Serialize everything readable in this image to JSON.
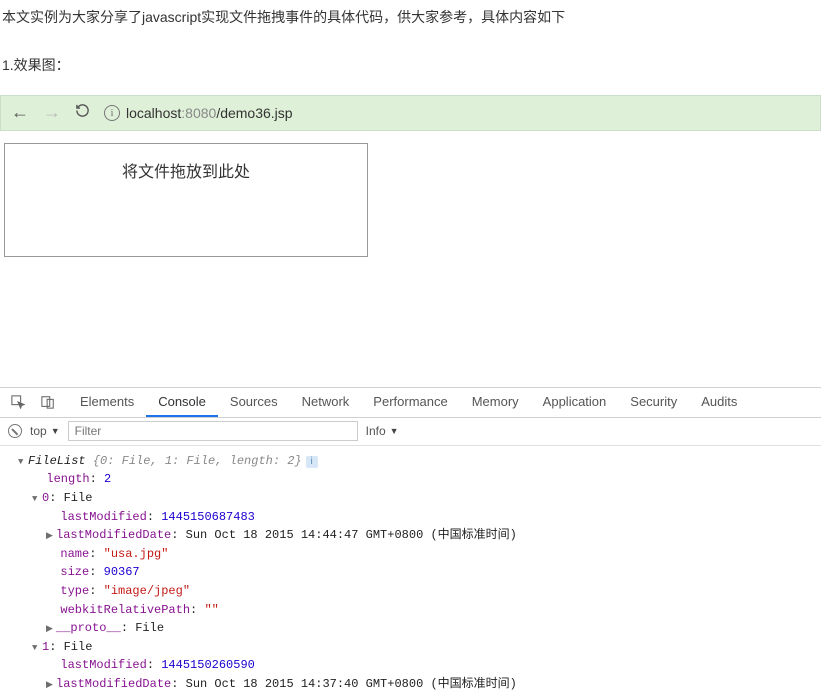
{
  "article": {
    "p1": "本文实例为大家分享了javascript实现文件拖拽事件的具体代码，供大家参考，具体内容如下",
    "p2": "1.效果图："
  },
  "browser": {
    "info_glyph": "i",
    "host": "localhost",
    "port": ":8080",
    "path": "/demo36.jsp"
  },
  "dropzone": {
    "text": "将文件拖放到此处"
  },
  "devtools": {
    "tabs": {
      "elements": "Elements",
      "console": "Console",
      "sources": "Sources",
      "network": "Network",
      "performance": "Performance",
      "memory": "Memory",
      "application": "Application",
      "security": "Security",
      "audits": "Audits"
    },
    "filter": {
      "context": "top",
      "tri": "▼",
      "placeholder": "Filter",
      "level": "Info"
    }
  },
  "console": {
    "filelist_label": "FileList ",
    "filelist_summary": "{0: File, 1: File, length: 2}",
    "length_k": "length",
    "length_v": "2",
    "idx0_k": "0",
    "idx1_k": "1",
    "file_type": "File",
    "lm_k": "lastModified",
    "lmd_k": "lastModifiedDate",
    "name_k": "name",
    "size_k": "size",
    "type_k": "type",
    "wrp_k": "webkitRelativePath",
    "proto_k": "__proto__",
    "f0": {
      "lm": "1445150687483",
      "lmd": "Sun Oct 18 2015 14:44:47 GMT+0800 (中国标准时间)",
      "name": "\"usa.jpg\"",
      "size": "90367",
      "type": "\"image/jpeg\"",
      "wrp": "\"\""
    },
    "f1": {
      "lm": "1445150260590",
      "lmd": "Sun Oct 18 2015 14:37:40 GMT+0800 (中国标准时间)"
    },
    "colon": ": "
  }
}
